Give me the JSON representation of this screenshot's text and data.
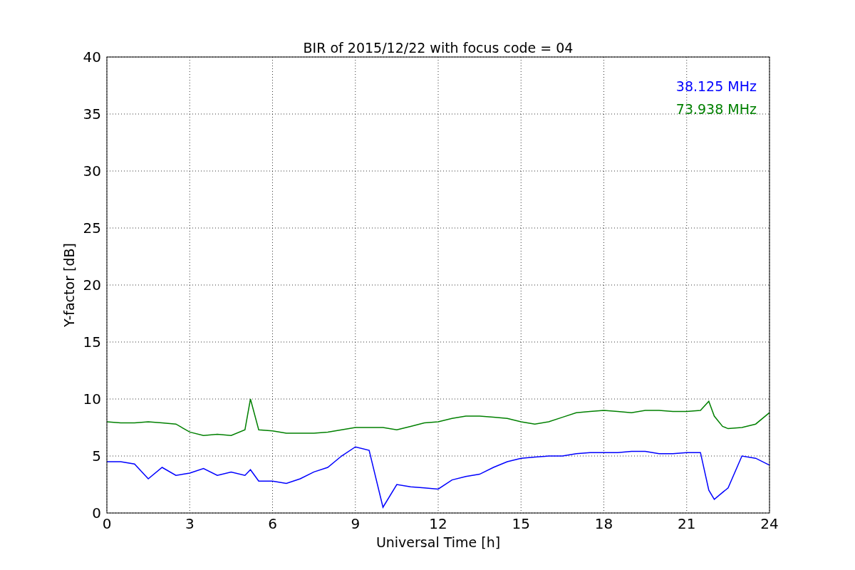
{
  "figure": {
    "chart_data": {
      "type": "line",
      "title": "BIR of 2015/12/22 with focus code = 04",
      "xlabel": "Universal Time [h]",
      "ylabel": "Y-factor [dB]",
      "x": [
        0,
        0.5,
        1,
        1.5,
        2,
        2.5,
        3,
        3.5,
        4,
        4.5,
        5,
        5.2,
        5.5,
        6,
        6.5,
        7,
        7.5,
        8,
        8.5,
        9,
        9.5,
        10,
        10.5,
        11,
        11.5,
        12,
        12.5,
        13,
        13.5,
        14,
        14.5,
        15,
        15.5,
        16,
        16.5,
        17,
        17.5,
        18,
        18.5,
        19,
        19.5,
        20,
        20.5,
        21,
        21.5,
        21.8,
        22,
        22.3,
        22.5,
        23,
        23.5,
        24
      ],
      "series": [
        {
          "name": "38.125 MHz",
          "color": "#0000ff",
          "values": [
            4.5,
            4.5,
            4.3,
            3.0,
            4.0,
            3.3,
            3.5,
            3.9,
            3.3,
            3.6,
            3.3,
            3.8,
            2.8,
            2.8,
            2.6,
            3.0,
            3.6,
            4.0,
            5.0,
            5.8,
            5.5,
            0.5,
            2.5,
            2.3,
            2.2,
            2.1,
            2.9,
            3.2,
            3.4,
            4.0,
            4.5,
            4.8,
            4.9,
            5.0,
            5.0,
            5.2,
            5.3,
            5.3,
            5.3,
            5.4,
            5.4,
            5.2,
            5.2,
            5.3,
            5.3,
            2.0,
            1.2,
            1.8,
            2.2,
            5.0,
            4.8,
            4.2
          ]
        },
        {
          "name": "73.938 MHz",
          "color": "#008000",
          "values": [
            8.0,
            7.9,
            7.9,
            8.0,
            7.9,
            7.8,
            7.1,
            6.8,
            6.9,
            6.8,
            7.3,
            10.0,
            7.3,
            7.2,
            7.0,
            7.0,
            7.0,
            7.1,
            7.3,
            7.5,
            7.5,
            7.5,
            7.3,
            7.6,
            7.9,
            8.0,
            8.3,
            8.5,
            8.5,
            8.4,
            8.3,
            8.0,
            7.8,
            8.0,
            8.4,
            8.8,
            8.9,
            9.0,
            8.9,
            8.8,
            9.0,
            9.0,
            8.9,
            8.9,
            9.0,
            9.8,
            8.5,
            7.6,
            7.4,
            7.5,
            7.8,
            8.8
          ]
        }
      ],
      "xlim": [
        0,
        24
      ],
      "ylim": [
        0,
        40
      ],
      "xticks": [
        0,
        3,
        6,
        9,
        12,
        15,
        18,
        21,
        24
      ],
      "yticks": [
        0,
        5,
        10,
        15,
        20,
        25,
        30,
        35,
        40
      ],
      "grid": true
    }
  }
}
